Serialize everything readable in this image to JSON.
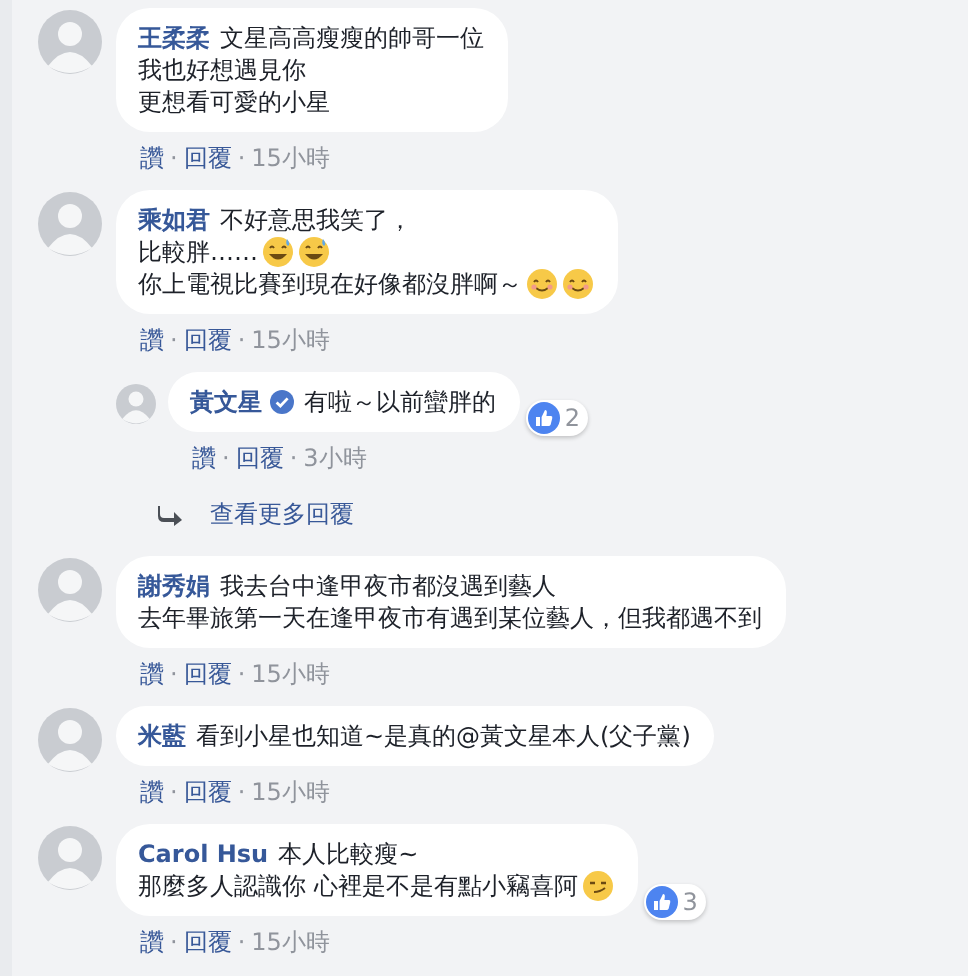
{
  "comments": [
    {
      "author": "王柔柔",
      "lines": [
        {
          "text": "文星高高瘦瘦的帥哥一位"
        },
        {
          "text": "我也好想遇見你"
        },
        {
          "text": "更想看可愛的小星"
        }
      ],
      "actions": {
        "like": "讚",
        "separator": "·",
        "reply": "回覆",
        "time": "15小時"
      }
    },
    {
      "author": "乘如君",
      "lines": [
        {
          "text": "不好意思我笑了，"
        },
        {
          "text": "比較胖……",
          "emojis": [
            {
              "kind": "grin_sweat"
            },
            {
              "kind": "grin_sweat"
            }
          ]
        },
        {
          "text": "你上電視比賽到現在好像都沒胖啊～",
          "emojis": [
            {
              "kind": "smile"
            },
            {
              "kind": "smile"
            }
          ]
        }
      ],
      "actions": {
        "like": "讚",
        "separator": "·",
        "reply": "回覆",
        "time": "15小時"
      },
      "replies": [
        {
          "author": "黃文星",
          "verified": true,
          "lines": [
            {
              "text": "有啦～以前蠻胖的"
            }
          ],
          "reactions": {
            "count": "2"
          },
          "actions": {
            "like": "讚",
            "separator": "·",
            "reply": "回覆",
            "time": "3小時"
          }
        }
      ],
      "more_replies": {
        "label": "查看更多回覆"
      }
    },
    {
      "author": "謝秀娟",
      "lines": [
        {
          "text": "我去台中逢甲夜市都沒遇到藝人"
        },
        {
          "text": "去年畢旅第一天在逢甲夜市有遇到某位藝人，但我都遇不到"
        }
      ],
      "actions": {
        "like": "讚",
        "separator": "·",
        "reply": "回覆",
        "time": "15小時"
      }
    },
    {
      "author": "米藍",
      "lines": [
        {
          "text": "看到小星也知道~是真的@黃文星本人(父子黨)"
        }
      ],
      "actions": {
        "like": "讚",
        "separator": "·",
        "reply": "回覆",
        "time": "15小時"
      }
    },
    {
      "author": "Carol Hsu",
      "lines": [
        {
          "text": "本人比較瘦~"
        },
        {
          "text": "那麼多人認識你 心裡是不是有點小竊喜阿",
          "emojis": [
            {
              "kind": "smirk"
            }
          ]
        }
      ],
      "reactions": {
        "count": "3"
      },
      "actions": {
        "like": "讚",
        "separator": "·",
        "reply": "回覆",
        "time": "15小時"
      }
    }
  ]
}
